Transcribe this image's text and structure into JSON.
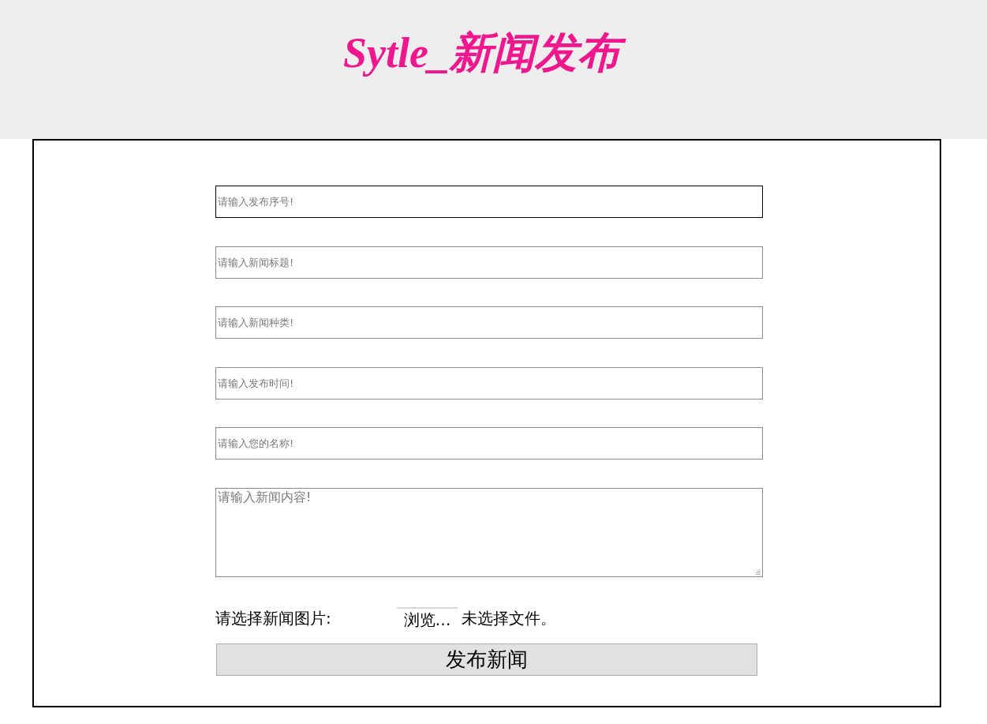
{
  "header": {
    "title": "Sytle_新闻发布"
  },
  "form": {
    "fields": [
      {
        "kind": "input",
        "placeholder": "请输入发布序号!",
        "focused": true
      },
      {
        "kind": "input",
        "placeholder": "请输入新闻标题!",
        "focused": false
      },
      {
        "kind": "input",
        "placeholder": "请输入新闻种类!",
        "focused": false
      },
      {
        "kind": "input",
        "placeholder": "请输入发布时间!",
        "focused": false
      },
      {
        "kind": "input",
        "placeholder": "请输入您的名称!",
        "focused": false
      },
      {
        "kind": "textarea",
        "placeholder": "请输入新闻内容!",
        "focused": false
      }
    ],
    "file_picker": {
      "label": "请选择新闻图片:",
      "button": "浏览…",
      "status": "未选择文件。"
    },
    "submit": {
      "label": "发布新闻"
    }
  }
}
